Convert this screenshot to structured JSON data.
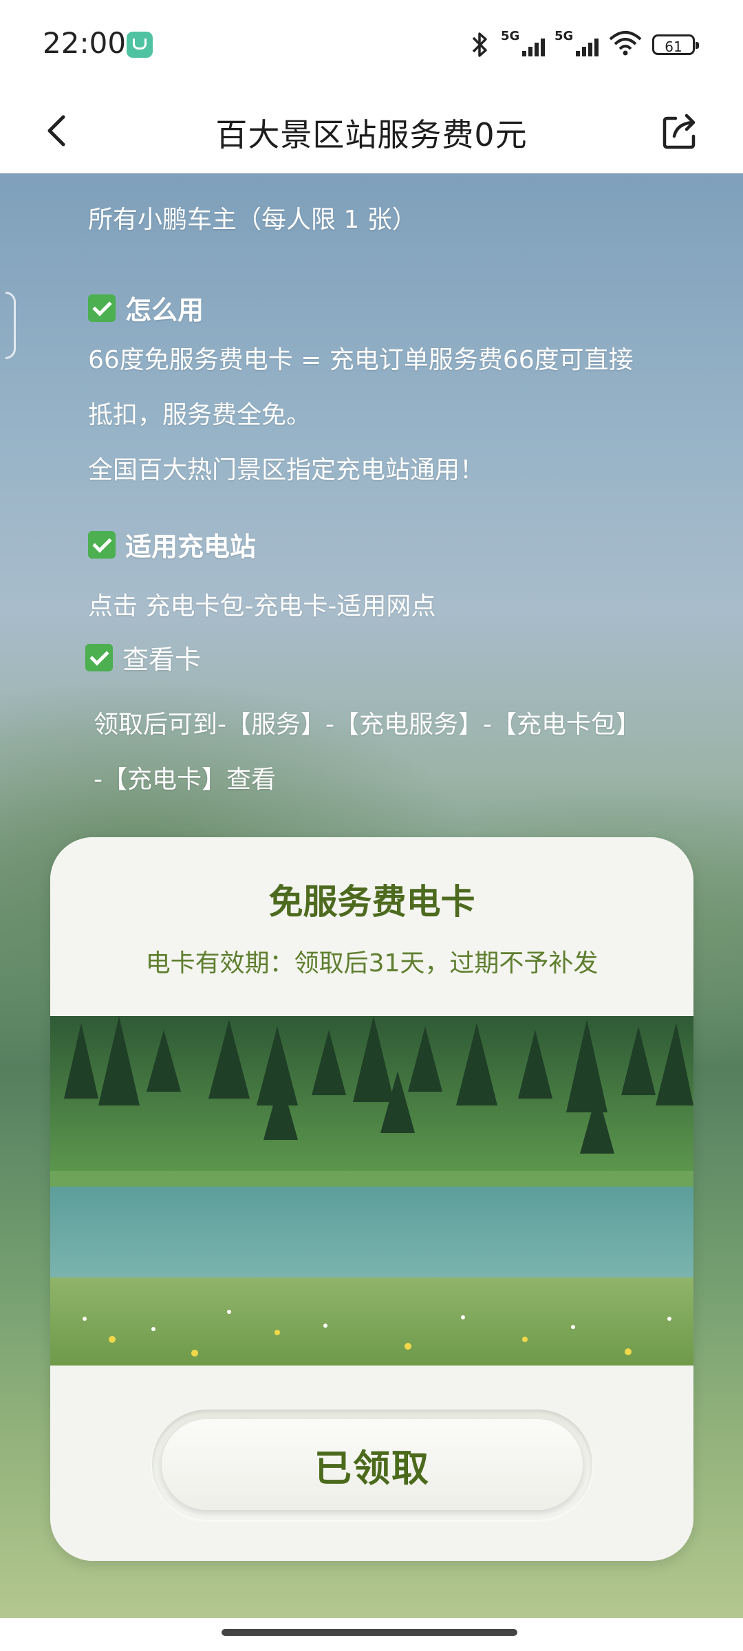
{
  "status_bar": {
    "time": "22:00",
    "signal1_label": "5G",
    "signal2_label": "5G",
    "battery": "61"
  },
  "nav": {
    "title": "百大景区站服务费0元"
  },
  "rules": {
    "who_text": "所有小鹏车主（每人限 1 张）",
    "how_title": "怎么用",
    "how_text_1": "66度免服务费电卡 = 充电订单服务费66度可直接",
    "how_text_2": "抵扣，服务费全免。",
    "how_text_3": "全国百大热门景区指定充电站通用！",
    "stations_title": "适用充电站",
    "stations_text": "点击 充电卡包-充电卡-适用网点",
    "view_title": "查看卡",
    "view_text_1": "领取后可到-【服务】-【充电服务】-【充电卡包】",
    "view_text_2": "-【充电卡】查看"
  },
  "card": {
    "title": "免服务费电卡",
    "subtitle": "电卡有效期：领取后31天，过期不予补发",
    "button_label": "已领取"
  },
  "colors": {
    "accent_green": "#4d6a1f",
    "check_green": "#4caf50"
  }
}
